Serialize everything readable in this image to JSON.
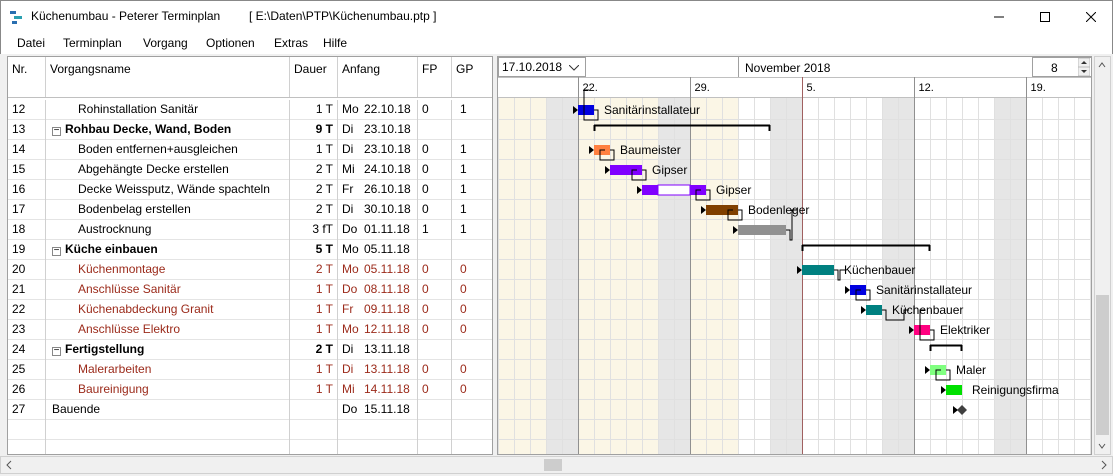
{
  "window": {
    "title": "Küchenumbau  -  Peterer Terminplan",
    "path": "[ E:\\Daten\\PTP\\Küchenumbau.ptp ]"
  },
  "menu": [
    "Datei",
    "Terminplan",
    "Vorgang",
    "Optionen",
    "Extras",
    "Hilfe"
  ],
  "table": {
    "headers": {
      "nr": "Nr.",
      "name": "Vorgangsname",
      "dauer": "Dauer",
      "anfang": "Anfang",
      "fp": "FP",
      "gp": "GP"
    },
    "rows": [
      {
        "nr": "12",
        "name": "Rohinstallation Sanitär",
        "indent": 2,
        "dauer": "1 T",
        "day": "Mo",
        "date": "22.10.18",
        "fp": "0",
        "gp": "1",
        "style": "normal"
      },
      {
        "nr": "13",
        "name": "Rohbau Decke, Wand, Boden",
        "indent": 1,
        "dauer": "9 T",
        "day": "Di",
        "date": "23.10.18",
        "fp": "",
        "gp": "",
        "style": "summary"
      },
      {
        "nr": "14",
        "name": "Boden entfernen+ausgleichen",
        "indent": 2,
        "dauer": "1 T",
        "day": "Di",
        "date": "23.10.18",
        "fp": "0",
        "gp": "1",
        "style": "normal"
      },
      {
        "nr": "15",
        "name": "Abgehängte Decke erstellen",
        "indent": 2,
        "dauer": "2 T",
        "day": "Mi",
        "date": "24.10.18",
        "fp": "0",
        "gp": "1",
        "style": "normal"
      },
      {
        "nr": "16",
        "name": "Decke Weissputz, Wände spachteln",
        "indent": 2,
        "dauer": "2 T",
        "day": "Fr",
        "date": "26.10.18",
        "fp": "0",
        "gp": "1",
        "style": "normal"
      },
      {
        "nr": "17",
        "name": "Bodenbelag erstellen",
        "indent": 2,
        "dauer": "2 T",
        "day": "Di",
        "date": "30.10.18",
        "fp": "0",
        "gp": "1",
        "style": "normal"
      },
      {
        "nr": "18",
        "name": "Austrocknung",
        "indent": 2,
        "dauer": "3 fT",
        "day": "Do",
        "date": "01.11.18",
        "fp": "1",
        "gp": "1",
        "style": "normal"
      },
      {
        "nr": "19",
        "name": "Küche einbauen",
        "indent": 1,
        "dauer": "5 T",
        "day": "Mo",
        "date": "05.11.18",
        "fp": "",
        "gp": "",
        "style": "summary"
      },
      {
        "nr": "20",
        "name": "Küchenmontage",
        "indent": 2,
        "dauer": "2 T",
        "day": "Mo",
        "date": "05.11.18",
        "fp": "0",
        "gp": "0",
        "style": "critical"
      },
      {
        "nr": "21",
        "name": "Anschlüsse Sanitär",
        "indent": 2,
        "dauer": "1 T",
        "day": "Do",
        "date": "08.11.18",
        "fp": "0",
        "gp": "0",
        "style": "critical"
      },
      {
        "nr": "22",
        "name": "Küchenabdeckung Granit",
        "indent": 2,
        "dauer": "1 T",
        "day": "Fr",
        "date": "09.11.18",
        "fp": "0",
        "gp": "0",
        "style": "critical"
      },
      {
        "nr": "23",
        "name": "Anschlüsse Elektro",
        "indent": 2,
        "dauer": "1 T",
        "day": "Mo",
        "date": "12.11.18",
        "fp": "0",
        "gp": "0",
        "style": "critical"
      },
      {
        "nr": "24",
        "name": "Fertigstellung",
        "indent": 1,
        "dauer": "2 T",
        "day": "Di",
        "date": "13.11.18",
        "fp": "",
        "gp": "",
        "style": "summary"
      },
      {
        "nr": "25",
        "name": "Malerarbeiten",
        "indent": 2,
        "dauer": "1 T",
        "day": "Di",
        "date": "13.11.18",
        "fp": "0",
        "gp": "0",
        "style": "critical"
      },
      {
        "nr": "26",
        "name": "Baureinigung",
        "indent": 2,
        "dauer": "1 T",
        "day": "Mi",
        "date": "14.11.18",
        "fp": "0",
        "gp": "0",
        "style": "critical"
      },
      {
        "nr": "27",
        "name": "Bauende",
        "indent": 1,
        "dauer": "",
        "day": "Do",
        "date": "15.11.18",
        "fp": "",
        "gp": "",
        "style": "normal"
      }
    ]
  },
  "gantt": {
    "date_select": "17.10.2018",
    "month_label": "November 2018",
    "zoom_value": "8",
    "week_labels": [
      "22.",
      "29.",
      "5.",
      "12.",
      "19."
    ],
    "start_date": "2018-10-17",
    "bars": [
      {
        "row": 0,
        "start": "2018-10-22",
        "days": 1,
        "color": "#0000e0",
        "label": "Sanitärinstallateur",
        "summary": false
      },
      {
        "row": 1,
        "start": "2018-10-23",
        "days": 11,
        "color": "#000000",
        "label": "",
        "summary": true
      },
      {
        "row": 2,
        "start": "2018-10-23",
        "days": 1,
        "color": "#ff8040",
        "label": "Baumeister",
        "summary": false
      },
      {
        "row": 3,
        "start": "2018-10-24",
        "days": 2,
        "color": "#8000ff",
        "label": "Gipser",
        "summary": false
      },
      {
        "row": 4,
        "start": "2018-10-26",
        "days": 4,
        "color": "#8000ff",
        "label": "Gipser",
        "summary": false,
        "split": true
      },
      {
        "row": 5,
        "start": "2018-10-30",
        "days": 2,
        "color": "#804000",
        "label": "Bodenleger",
        "summary": false
      },
      {
        "row": 6,
        "start": "2018-11-01",
        "days": 3,
        "color": "#909090",
        "label": "",
        "summary": false
      },
      {
        "row": 7,
        "start": "2018-11-05",
        "days": 8,
        "color": "#000000",
        "label": "",
        "summary": true
      },
      {
        "row": 8,
        "start": "2018-11-05",
        "days": 2,
        "color": "#008080",
        "label": "Küchenbauer",
        "summary": false
      },
      {
        "row": 9,
        "start": "2018-11-08",
        "days": 1,
        "color": "#0000e0",
        "label": "Sanitärinstallateur",
        "summary": false
      },
      {
        "row": 10,
        "start": "2018-11-09",
        "days": 1,
        "color": "#008080",
        "label": "Küchenbauer",
        "summary": false
      },
      {
        "row": 11,
        "start": "2018-11-12",
        "days": 1,
        "color": "#ff0080",
        "label": "Elektriker",
        "summary": false
      },
      {
        "row": 12,
        "start": "2018-11-13",
        "days": 2,
        "color": "#000000",
        "label": "",
        "summary": true
      },
      {
        "row": 13,
        "start": "2018-11-13",
        "days": 1,
        "color": "#80ff80",
        "label": "Maler",
        "summary": false
      },
      {
        "row": 14,
        "start": "2018-11-14",
        "days": 1,
        "color": "#00e000",
        "label": "Reinigungsfirma",
        "summary": false
      },
      {
        "row": 15,
        "start": "2018-11-15",
        "days": 0,
        "color": "#404040",
        "label": "",
        "milestone": true
      }
    ]
  }
}
